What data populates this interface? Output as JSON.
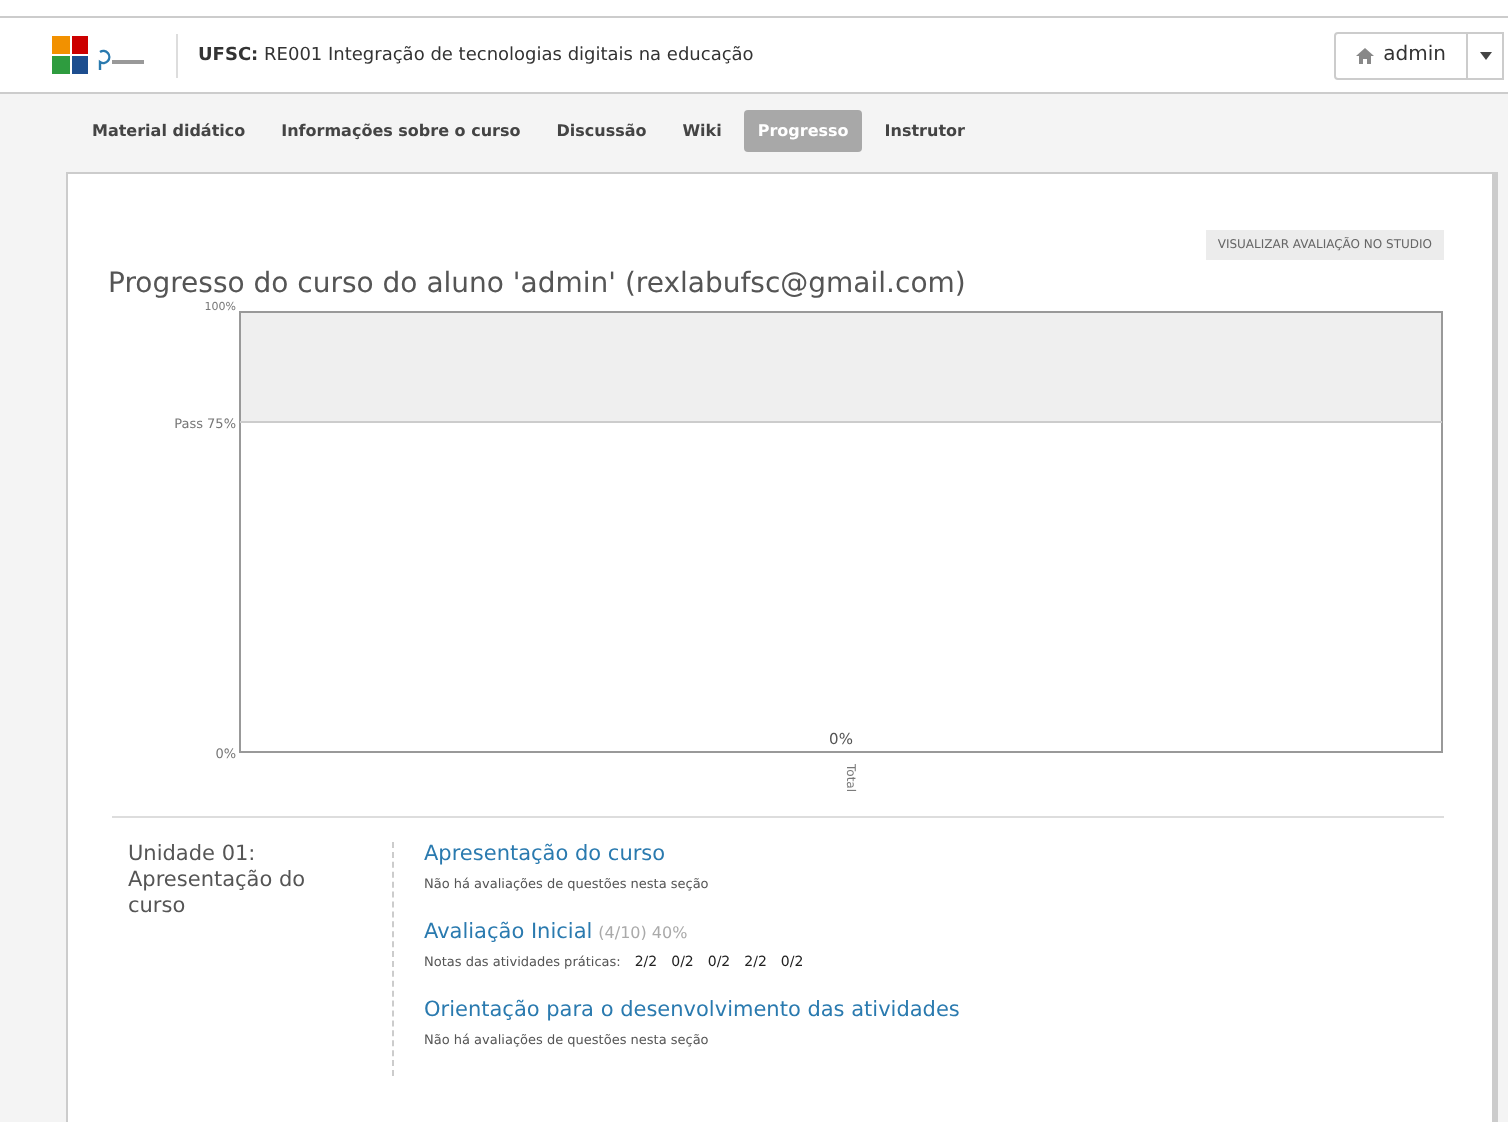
{
  "header": {
    "course_org": "UFSC:",
    "course_title": "RE001 Integração de tecnologias digitais na educação",
    "user": "admin"
  },
  "tabs": [
    {
      "label": "Material didático",
      "selected": false
    },
    {
      "label": "Informações sobre o curso",
      "selected": false
    },
    {
      "label": "Discussão",
      "selected": false
    },
    {
      "label": "Wiki",
      "selected": false
    },
    {
      "label": "Progresso",
      "selected": true
    },
    {
      "label": "Instrutor",
      "selected": false
    }
  ],
  "studio_button": "VISUALIZAR AVALIAÇÃO NO STUDIO",
  "progress_title": "Progresso do curso do aluno 'admin' (rexlabufsc@gmail.com)",
  "chart_data": {
    "type": "bar",
    "categories": [
      "Total"
    ],
    "values": [
      0
    ],
    "ylim": [
      0,
      100
    ],
    "yticks": [
      {
        "value": 0,
        "label": "0%"
      },
      {
        "value": 75,
        "label": "Pass 75%"
      },
      {
        "value": 100,
        "label": "100%"
      }
    ],
    "value_labels": [
      "0%"
    ]
  },
  "chapters": [
    {
      "name": "Unidade 01: Apresentação do curso",
      "sections": [
        {
          "title": "Apresentação do curso",
          "note": "Não há avaliações de questões nesta seção"
        },
        {
          "title": "Avaliação Inicial",
          "score": "(4/10) 40%",
          "scores_label": "Notas das atividades práticas:",
          "scores": [
            "2/2",
            "0/2",
            "0/2",
            "2/2",
            "0/2"
          ]
        },
        {
          "title": "Orientação para o desenvolvimento das atividades",
          "note": "Não há avaliações de questões nesta seção"
        }
      ]
    }
  ]
}
